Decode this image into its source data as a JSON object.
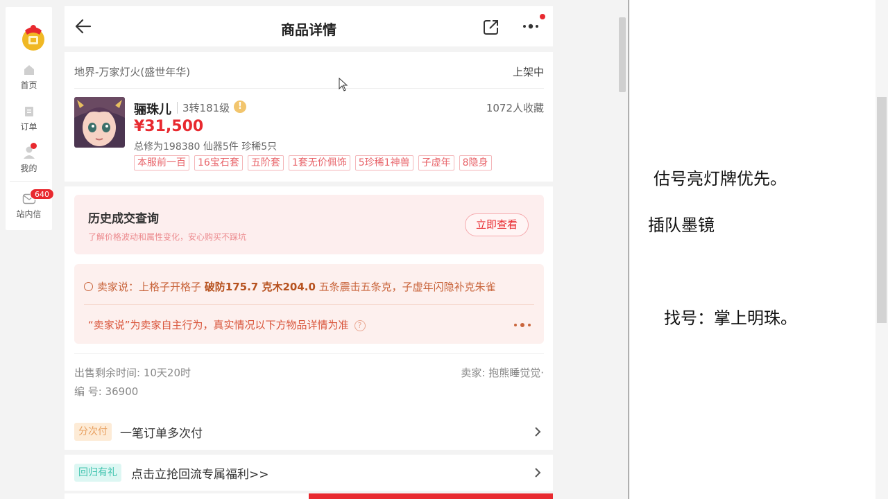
{
  "nav": {
    "items": [
      {
        "label": "首页",
        "icon": "home-icon"
      },
      {
        "label": "订单",
        "icon": "order-icon"
      },
      {
        "label": "我的",
        "icon": "user-icon"
      },
      {
        "label": "站内信",
        "icon": "mail-icon"
      }
    ],
    "mail_badge": "640"
  },
  "header": {
    "title": "商品详情"
  },
  "product": {
    "server": "地界-万家灯火(盛世年华)",
    "status": "上架中",
    "role_name": "骊珠儿",
    "level": "3转181级",
    "favorites": "1072人收藏",
    "price": "¥31,500",
    "stats": "总修为198380  仙器5件  珍稀5只",
    "tags": [
      "本服前一百",
      "16宝石套",
      "五阶套",
      "1套无价佩饰",
      "5珍稀1神兽",
      "子虚年",
      "8隐身"
    ]
  },
  "history": {
    "title": "历史成交查询",
    "subtitle": "了解价格波动和属性变化，安心购买不踩坑",
    "button": "立即查看"
  },
  "seller_says": {
    "prefix": "卖家说：上格子开格子 ",
    "highlight": "破防175.7 克木204.0",
    "suffix": " 五条震击五条克，子虚年闪隐补克朱雀",
    "disclaimer": "“卖家说”为卖家自主行为，真实情况以下方物品详情为准"
  },
  "meta": {
    "remaining": "出售剩余时间: 10天20时",
    "seller": "卖家: 抱熊睡觉觉·",
    "serial": "编 号: 36900"
  },
  "rows": [
    {
      "tag": "分次付",
      "text": "一笔订单多次付"
    },
    {
      "tag": "回归有礼",
      "text": "点击立抢回流专属福利>>"
    }
  ],
  "notes": [
    "估号亮灯牌优先。",
    "插队墨镜",
    "找号：掌上明珠。"
  ],
  "colors": {
    "accent_red": "#e8292f",
    "tag_border": "#f4b6b9",
    "seller_text": "#c9653c"
  }
}
